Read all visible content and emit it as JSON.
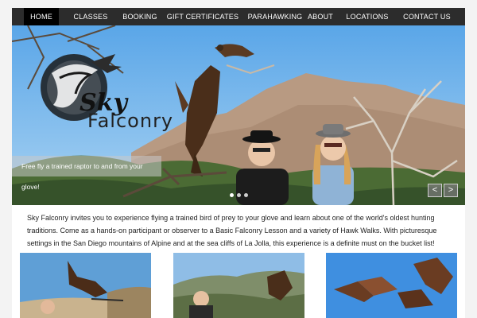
{
  "nav": {
    "items": [
      {
        "label": "HOME",
        "active": true
      },
      {
        "label": "CLASSES",
        "active": false
      },
      {
        "label": "BOOKING",
        "active": false
      },
      {
        "label": "GIFT CERTIFICATES",
        "active": false
      },
      {
        "label": "PARAHAWKING",
        "active": false
      },
      {
        "label": "ABOUT",
        "active": false
      },
      {
        "label": "LOCATIONS",
        "active": false
      },
      {
        "label": "CONTACT US",
        "active": false
      }
    ]
  },
  "logo": {
    "word1": "Sky",
    "word2": "Falconry"
  },
  "slider": {
    "caption": "Free fly a trained raptor to and from your glove!",
    "prev_icon": "arrow-left-icon",
    "next_icon": "arrow-right-icon",
    "prev_glyph": "<",
    "next_glyph": ">",
    "dots": 3,
    "active_dot": 0
  },
  "intro": {
    "text": "Sky Falconry invites you to experience flying a trained bird of prey to your glove and learn about one of the world's oldest hunting traditions. Come as a hands-on participant or observer to a Basic Falconry Lesson and a variety of Hawk Walks. With picturesque settings in the San Diego mountains of Alpine and at the sea cliffs of La Jolla, this experience is a definite must on the bucket list!"
  },
  "colors": {
    "nav_bg": "#2c2c2c",
    "nav_active": "#000000",
    "sky": "#6fb6ee",
    "mountain": "#b89a82"
  }
}
